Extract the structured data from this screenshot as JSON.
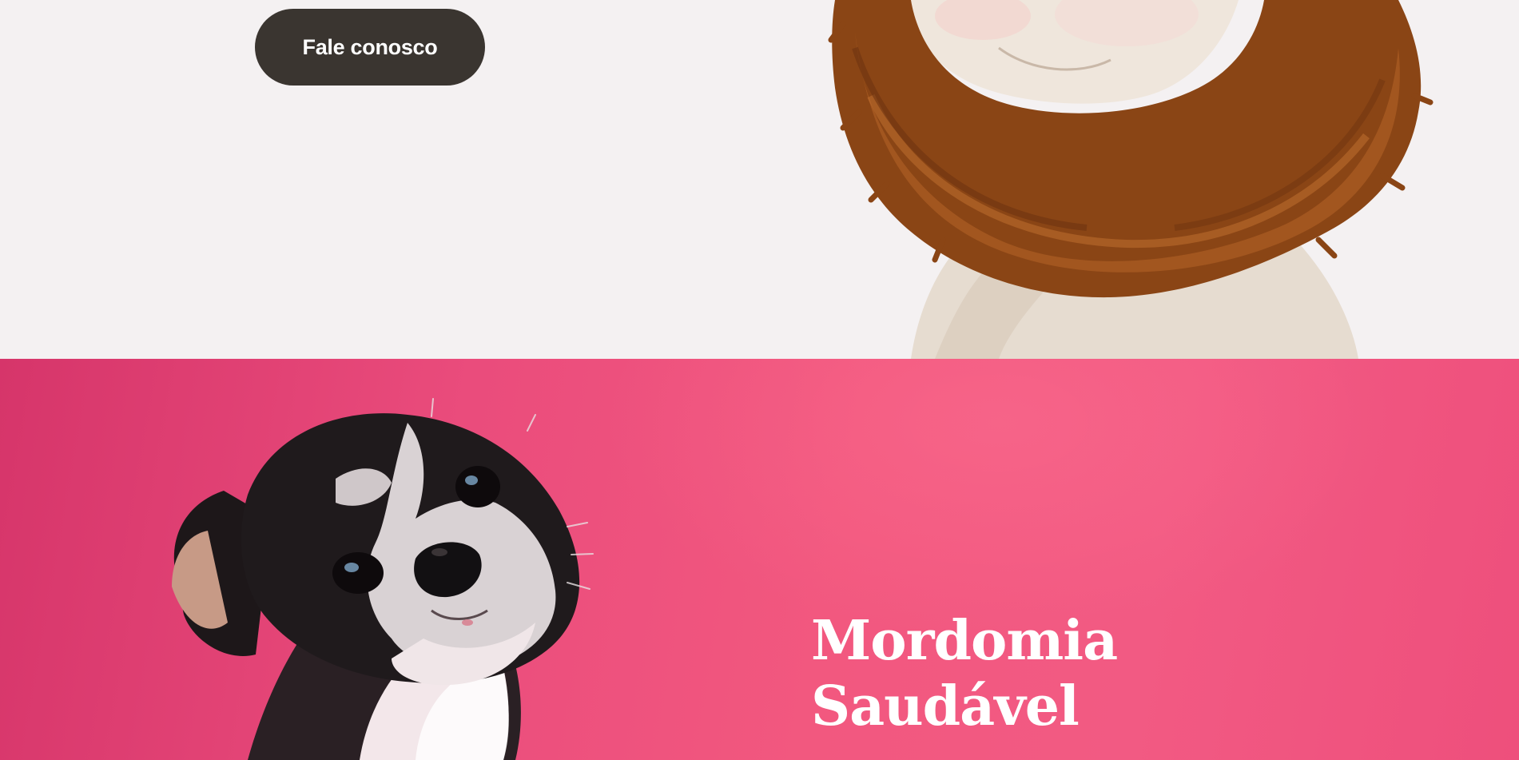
{
  "top_section": {
    "cta_label": "Fale conosco",
    "background_color": "#f4f1f2",
    "button_color": "#3a3530",
    "image": "dog-with-brown-fluffy-scarf"
  },
  "bottom_section": {
    "title_line1": "Mordomia",
    "title_line2": "Saudável",
    "background_color": "#ea4c7c",
    "image": "small-black-white-dog-looking-up"
  }
}
